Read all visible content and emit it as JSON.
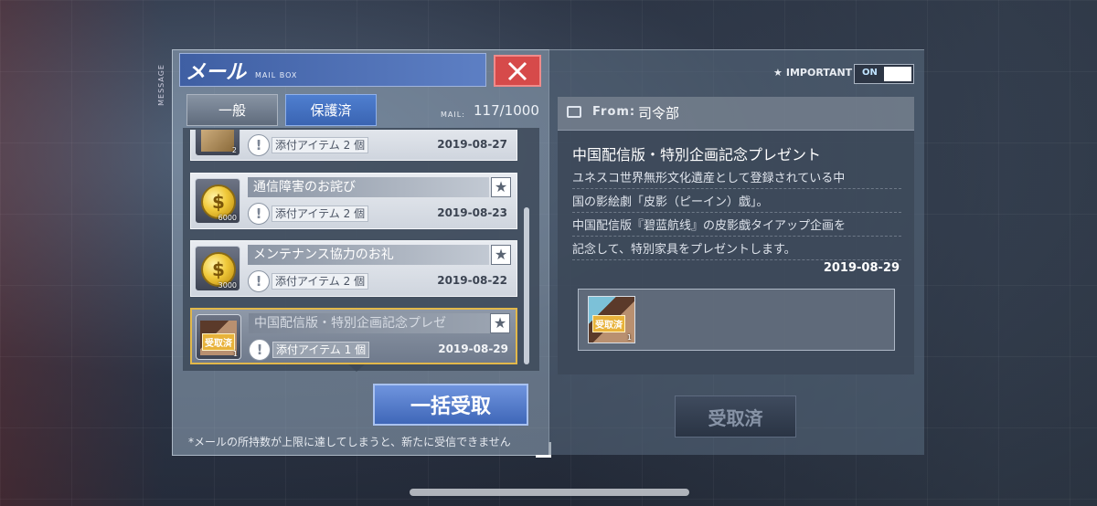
{
  "side_label": "MESSAGE",
  "header": {
    "title": "メール",
    "subtitle": "MAIL BOX"
  },
  "tabs": [
    {
      "label": "一般"
    },
    {
      "label": "保護済"
    }
  ],
  "mail_counter": {
    "label": "MAIL:",
    "value": "117/1000"
  },
  "mails": [
    {
      "subject": "",
      "icon": "item-icon",
      "amount": "2",
      "attachment": "添付アイテム 2 個",
      "date": "2019-08-27"
    },
    {
      "subject": "通信障害のお詫び",
      "icon": "coin-icon",
      "amount": "6000",
      "attachment": "添付アイテム 2 個",
      "date": "2019-08-23"
    },
    {
      "subject": "メンテナンス協力のお礼",
      "icon": "coin-icon",
      "amount": "3000",
      "attachment": "添付アイテム 2 個",
      "date": "2019-08-22"
    },
    {
      "subject": "中国配信版・特別企画記念プレゼ",
      "icon": "furniture-icon",
      "amount": "1",
      "stamp": "受取済",
      "attachment": "添付アイテム 1 個",
      "date": "2019-08-29",
      "selected": true
    }
  ],
  "bulk_receive_label": "一括受取",
  "notice": "*メールの所持数が上限に達してしまうと、新たに受信できません",
  "important": {
    "label": "IMPORTANT",
    "toggle": "ON"
  },
  "detail": {
    "from_label": "From:",
    "from_name": "司令部",
    "title": "中国配信版・特別企画記念プレゼント",
    "body": [
      "ユネスコ世界無形文化遺産として登録されている中",
      "国の影絵劇「皮影（ピーイン）戯」。",
      "中国配信版『碧蓝航线』の皮影戯タイアップ企画を",
      "記念して、特別家具をプレゼントします。"
    ],
    "date": "2019-08-29",
    "attachment": {
      "stamp": "受取済",
      "amount": "1"
    },
    "received_label": "受取済"
  },
  "colors": {
    "accent": "#3f64b2",
    "close": "#d64a4a",
    "selected_border": "#e2b84a"
  }
}
